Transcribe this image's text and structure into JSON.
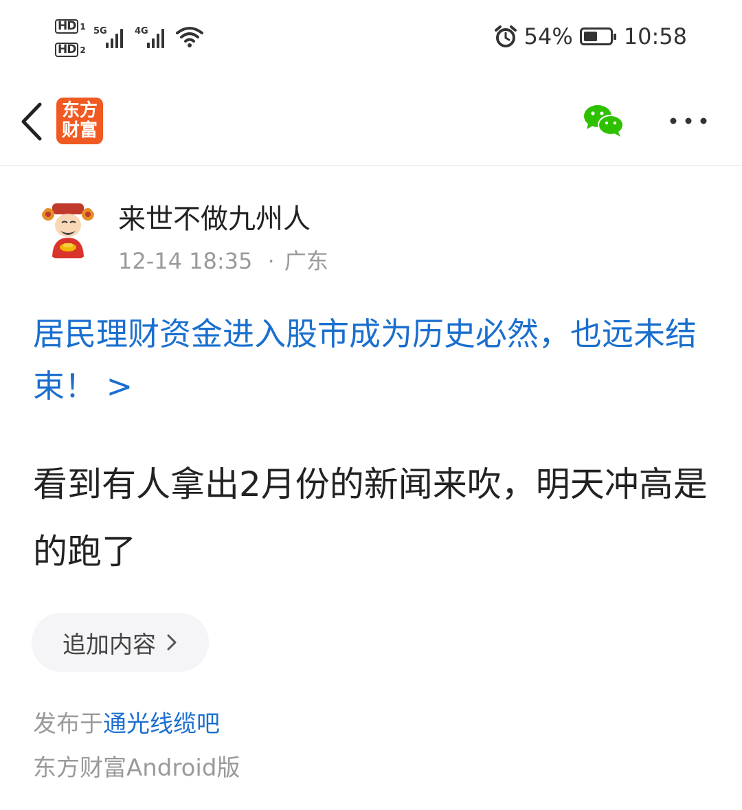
{
  "status_bar": {
    "hd1": "HD",
    "hd1_sub": "1",
    "hd2": "HD",
    "hd2_sub": "2",
    "net1": "5G",
    "net2": "4G",
    "battery_percent": "54%",
    "battery_level": 0.54,
    "time": "10:58"
  },
  "header": {
    "logo_line1": "东方",
    "logo_line2": "财富"
  },
  "post": {
    "author": "来世不做九州人",
    "timestamp": "12-14 18:35",
    "separator": "·",
    "location": "广东",
    "link_title": "居民理财资金进入股市成为历史必然，也远未结束！ >",
    "body": "看到有人拿出2月份的新闻来吹，明天冲高是的跑了",
    "add_content_label": "追加内容",
    "posted_prefix": "发布于",
    "bar_name": "通光线缆吧",
    "client": "东方财富Android版"
  },
  "colors": {
    "link": "#1a6fcf",
    "brand": "#f05a22",
    "wechat": "#2dc100",
    "muted": "#9a9a9a"
  },
  "icons": [
    "back-icon",
    "app-logo",
    "wechat-icon",
    "more-icon",
    "alarm-icon",
    "battery-icon",
    "wifi-icon",
    "chevron-right-icon"
  ]
}
